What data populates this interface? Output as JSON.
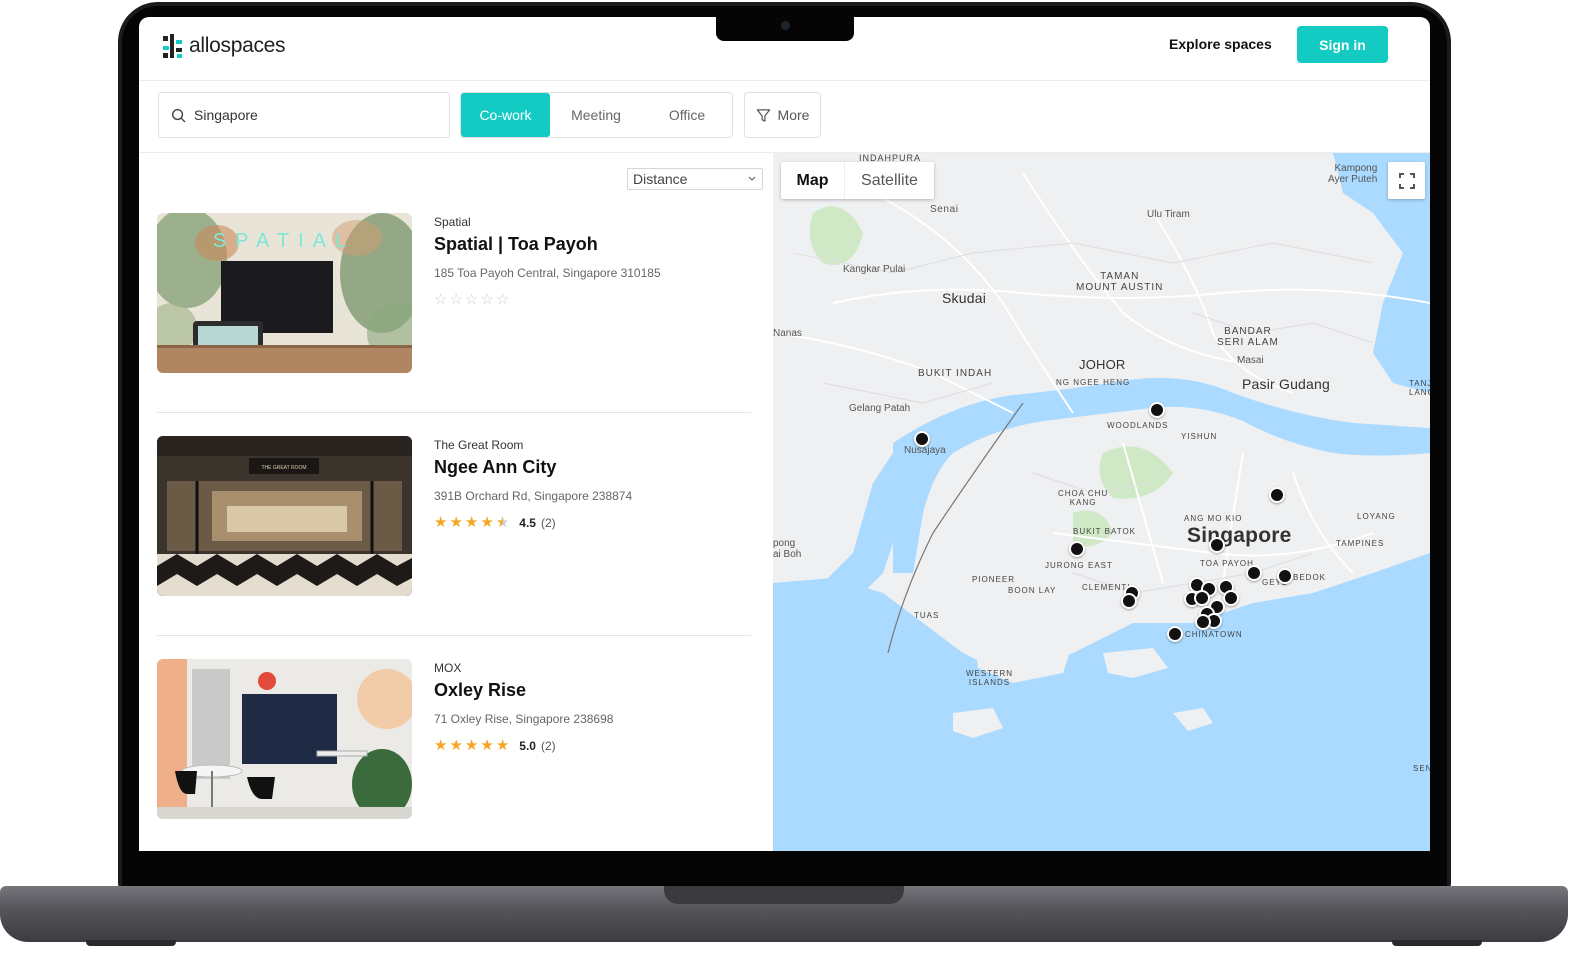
{
  "brand": {
    "name": "allospaces",
    "accent": "#14cbc4"
  },
  "nav": {
    "explore_label": "Explore spaces",
    "signin_label": "Sign in"
  },
  "search": {
    "value": "Singapore",
    "icon": "search-icon"
  },
  "space_types": [
    {
      "label": "Co-work",
      "active": true
    },
    {
      "label": "Meeting",
      "active": false
    },
    {
      "label": "Office",
      "active": false
    }
  ],
  "more_filter": {
    "label": "More",
    "icon": "filter-icon"
  },
  "sort": {
    "selected": "Distance"
  },
  "listings": [
    {
      "brand": "Spatial",
      "title": "Spatial | Toa Payoh",
      "address": "185 Toa Payoh Central, Singapore 310185",
      "rating": 0,
      "score": "",
      "count": "",
      "image_sign": "SPATIAL"
    },
    {
      "brand": "The Great Room",
      "title": "Ngee Ann City",
      "address": "391B Orchard Rd, Singapore 238874",
      "rating": 4.5,
      "score": "4.5",
      "count": "(2)",
      "image_sign": "THE GREAT ROOM"
    },
    {
      "brand": "MOX",
      "title": "Oxley Rise",
      "address": "71 Oxley Rise, Singapore 238698",
      "rating": 5.0,
      "score": "5.0",
      "count": "(2)",
      "image_sign": ""
    }
  ],
  "map": {
    "toggle": {
      "map_label": "Map",
      "satellite_label": "Satellite",
      "active": "Map"
    },
    "fullscreen_icon": "fullscreen-icon",
    "labels": {
      "indahpura": "INDAHPURA",
      "senai": "Senai",
      "kampong_ayer_puteh": "Kampong\nAyer Puteh",
      "ulu_tiram": "Ulu Tiram",
      "kangkar_pulai": "Kangkar Pulai",
      "taman_mount_austin": "TAMAN\nMOUNT AUSTIN",
      "skudai": "Skudai",
      "nanas": "Nanas",
      "bandar_seri_alam": "BANDAR\nSERI ALAM",
      "johor": "JOHOR",
      "masai": "Masai",
      "bukit_indah": "BUKIT INDAH",
      "ng_ngee_heng": "NG NGEE HENG",
      "pasir_gudang": "Pasir Gudang",
      "tanjung_langsat": "TANJU\nLANGS",
      "gelang_patah": "Gelang Patah",
      "woodlands": "WOODLANDS",
      "nusajaya": "Nusajaya",
      "yishun": "YISHUN",
      "choa_chu_kang": "CHOA CHU\nKANG",
      "ang_mo_kio": "ANG MO KIO",
      "loyang": "LOYANG",
      "bukit_batok": "BUKIT BATOK",
      "singapore": "Singapore",
      "tampines": "TAMPINES",
      "pong_ai_boh": "pong\nai Boh",
      "jurong_east": "JURONG EAST",
      "toa_payoh": "TOA PAYOH",
      "geylang": "GEYL",
      "bedok": "BEDOK",
      "pioneer": "PIONEER",
      "boon_lay": "BOON LAY",
      "clementi": "CLEMENTI",
      "tuas": "TUAS",
      "chinatown": "CHINATOWN",
      "western_islands": "WESTERN\nISLANDS",
      "sen": "SEN"
    }
  }
}
